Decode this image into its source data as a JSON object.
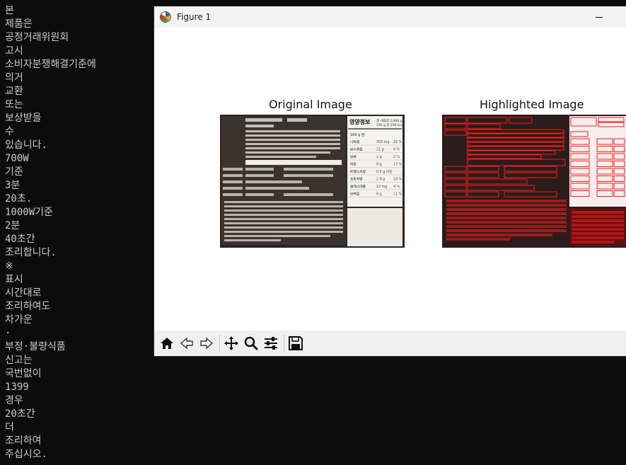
{
  "terminal": {
    "lines": [
      "본",
      "제품은",
      "공정거래위원회",
      "고시",
      "소비자분쟁해결기준에",
      "의거",
      "교환",
      "또는",
      "보상받을",
      "수",
      "있습니다.",
      "700W",
      "기준",
      "3분",
      "20초.",
      "1000W기준",
      "2분",
      "40초간",
      "조리합니다.",
      "※",
      "표시",
      "시간대로",
      "조리하여도",
      "차가운",
      "·",
      "부정·불량식품",
      "신고는",
      "국번없이",
      "1399",
      "경우",
      "20초간",
      "더",
      "조리하여",
      "주십시오."
    ]
  },
  "window": {
    "title": "Figure 1",
    "icons": {
      "app": "matplotlib-icon",
      "minimize": "minimize-icon"
    }
  },
  "figure": {
    "left_title": "Original Image",
    "right_title": "Highlighted Image",
    "left_image": {
      "label_nutrition": "영양정보",
      "label_total": "총 내용량 2,800 g",
      "label_per": "100 g 당 190 kcal",
      "label_serving": "100 g 당",
      "rows": [
        {
          "name": "나트륨",
          "amount": "305 mg",
          "pct": "15 %"
        },
        {
          "name": "탄수화물",
          "amount": "21 g",
          "pct": "6 %"
        },
        {
          "name": "당류",
          "amount": "2 g",
          "pct": "2 %"
        },
        {
          "name": "지방",
          "amount": "9 g",
          "pct": "17 %"
        },
        {
          "name": "트랜스지방",
          "amount": "0.5 g 미만",
          "pct": ""
        },
        {
          "name": "포화지방",
          "amount": "2.9 g",
          "pct": "19 %"
        },
        {
          "name": "콜레스테롤",
          "amount": "12 mg",
          "pct": "4 %"
        },
        {
          "name": "단백질",
          "amount": "6 g",
          "pct": "11 %"
        }
      ]
    }
  },
  "toolbar": {
    "buttons": [
      "home-icon",
      "back-icon",
      "forward-icon",
      "pan-icon",
      "zoom-icon",
      "configure-icon",
      "save-icon"
    ]
  },
  "colors": {
    "terminal_bg": "#0c0c0c",
    "terminal_fg": "#cccccc",
    "highlight": "#ff1a1a"
  }
}
